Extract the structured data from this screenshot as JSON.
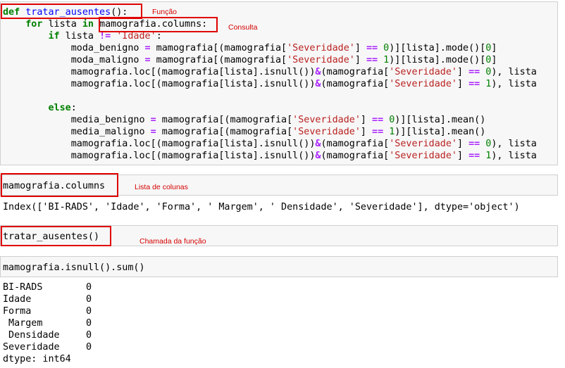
{
  "cell1": {
    "lines": [
      [
        {
          "t": "def",
          "c": "kw"
        },
        {
          "t": " "
        },
        {
          "t": "tratar_ausentes",
          "c": "fn"
        },
        {
          "t": "():"
        }
      ],
      [
        {
          "t": "    "
        },
        {
          "t": "for",
          "c": "kw"
        },
        {
          "t": " lista "
        },
        {
          "t": "in",
          "c": "kw"
        },
        {
          "t": " mamografia.columns:"
        }
      ],
      [
        {
          "t": "        "
        },
        {
          "t": "if",
          "c": "kw"
        },
        {
          "t": " lista "
        },
        {
          "t": "!=",
          "c": "op"
        },
        {
          "t": " "
        },
        {
          "t": "'Idade'",
          "c": "str"
        },
        {
          "t": ":"
        }
      ],
      [
        {
          "t": "            moda_benigno "
        },
        {
          "t": "=",
          "c": "op"
        },
        {
          "t": " mamografia[(mamografia["
        },
        {
          "t": "'Severidade'",
          "c": "str"
        },
        {
          "t": "] "
        },
        {
          "t": "==",
          "c": "op"
        },
        {
          "t": " "
        },
        {
          "t": "0",
          "c": "num"
        },
        {
          "t": ")][lista].mode()["
        },
        {
          "t": "0",
          "c": "num"
        },
        {
          "t": "]"
        }
      ],
      [
        {
          "t": "            moda_maligno "
        },
        {
          "t": "=",
          "c": "op"
        },
        {
          "t": " mamografia[(mamografia["
        },
        {
          "t": "'Severidade'",
          "c": "str"
        },
        {
          "t": "] "
        },
        {
          "t": "==",
          "c": "op"
        },
        {
          "t": " "
        },
        {
          "t": "1",
          "c": "num"
        },
        {
          "t": ")][lista].mode()["
        },
        {
          "t": "0",
          "c": "num"
        },
        {
          "t": "]"
        }
      ],
      [
        {
          "t": "            mamografia.loc[(mamografia[lista].isnull())"
        },
        {
          "t": "&",
          "c": "op"
        },
        {
          "t": "(mamografia["
        },
        {
          "t": "'Severidade'",
          "c": "str"
        },
        {
          "t": "] "
        },
        {
          "t": "==",
          "c": "op"
        },
        {
          "t": " "
        },
        {
          "t": "0",
          "c": "num"
        },
        {
          "t": "), lista"
        }
      ],
      [
        {
          "t": "            mamografia.loc[(mamografia[lista].isnull())"
        },
        {
          "t": "&",
          "c": "op"
        },
        {
          "t": "(mamografia["
        },
        {
          "t": "'Severidade'",
          "c": "str"
        },
        {
          "t": "] "
        },
        {
          "t": "==",
          "c": "op"
        },
        {
          "t": " "
        },
        {
          "t": "1",
          "c": "num"
        },
        {
          "t": "), lista"
        }
      ],
      [
        {
          "t": ""
        }
      ],
      [
        {
          "t": "        "
        },
        {
          "t": "else",
          "c": "kw"
        },
        {
          "t": ":"
        }
      ],
      [
        {
          "t": "            media_benigno "
        },
        {
          "t": "=",
          "c": "op"
        },
        {
          "t": " mamografia[(mamografia["
        },
        {
          "t": "'Severidade'",
          "c": "str"
        },
        {
          "t": "] "
        },
        {
          "t": "==",
          "c": "op"
        },
        {
          "t": " "
        },
        {
          "t": "0",
          "c": "num"
        },
        {
          "t": ")][lista].mean()"
        }
      ],
      [
        {
          "t": "            media_maligno "
        },
        {
          "t": "=",
          "c": "op"
        },
        {
          "t": " mamografia[(mamografia["
        },
        {
          "t": "'Severidade'",
          "c": "str"
        },
        {
          "t": "] "
        },
        {
          "t": "==",
          "c": "op"
        },
        {
          "t": " "
        },
        {
          "t": "1",
          "c": "num"
        },
        {
          "t": ")][lista].mean()"
        }
      ],
      [
        {
          "t": "            mamografia.loc[(mamografia[lista].isnull())"
        },
        {
          "t": "&",
          "c": "op"
        },
        {
          "t": "(mamografia["
        },
        {
          "t": "'Severidade'",
          "c": "str"
        },
        {
          "t": "] "
        },
        {
          "t": "==",
          "c": "op"
        },
        {
          "t": " "
        },
        {
          "t": "0",
          "c": "num"
        },
        {
          "t": "), lista"
        }
      ],
      [
        {
          "t": "            mamografia.loc[(mamografia[lista].isnull())"
        },
        {
          "t": "&",
          "c": "op"
        },
        {
          "t": "(mamografia["
        },
        {
          "t": "'Severidade'",
          "c": "str"
        },
        {
          "t": "] "
        },
        {
          "t": "==",
          "c": "op"
        },
        {
          "t": " "
        },
        {
          "t": "1",
          "c": "num"
        },
        {
          "t": "), lista"
        }
      ]
    ]
  },
  "cell2": {
    "code": "mamografia.columns",
    "output": "Index(['BI-RADS', 'Idade', 'Forma', ' Margem', ' Densidade', 'Severidade'], dtype='object')"
  },
  "cell3": {
    "code": "tratar_ausentes()"
  },
  "cell4": {
    "code": "mamografia.isnull().sum()",
    "rows": [
      {
        "key": "BI-RADS",
        "value": "0"
      },
      {
        "key": "Idade",
        "value": "0"
      },
      {
        "key": "Forma",
        "value": "0"
      },
      {
        "key": " Margem",
        "value": "0"
      },
      {
        "key": " Densidade",
        "value": "0"
      },
      {
        "key": "Severidade",
        "value": "0"
      }
    ],
    "dtype": "dtype: int64"
  },
  "annotations": {
    "funcao": "Função",
    "consulta": "Consulta",
    "lista_colunas": "Lista de colunas",
    "chamada": "Chamada da função"
  }
}
